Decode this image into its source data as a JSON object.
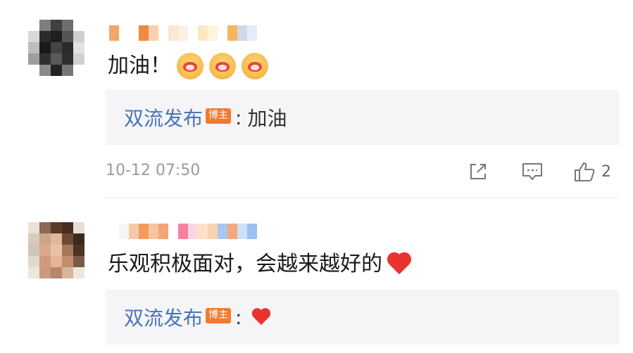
{
  "comments": [
    {
      "text": "加油！",
      "emoji_count": 3,
      "emoji_icon": "hug-emoji-icon",
      "reply": {
        "author": "双流发布",
        "badge": "博主",
        "separator": ":",
        "text": "加油"
      },
      "time": "10-12 07:50",
      "likes": "2"
    },
    {
      "text": "乐观积极面对，会越来越好的",
      "trailing_icon": "red-heart-icon",
      "reply": {
        "author": "双流发布",
        "badge": "博主",
        "separator": ":",
        "reply_icon": "red-heart-icon"
      }
    }
  ],
  "colors": {
    "author_link": "#4a73b8",
    "badge_bg": "#f27a30",
    "timestamp": "#9b9b9b",
    "reply_bg": "#f5f5f7",
    "heart": "#e8332e"
  }
}
